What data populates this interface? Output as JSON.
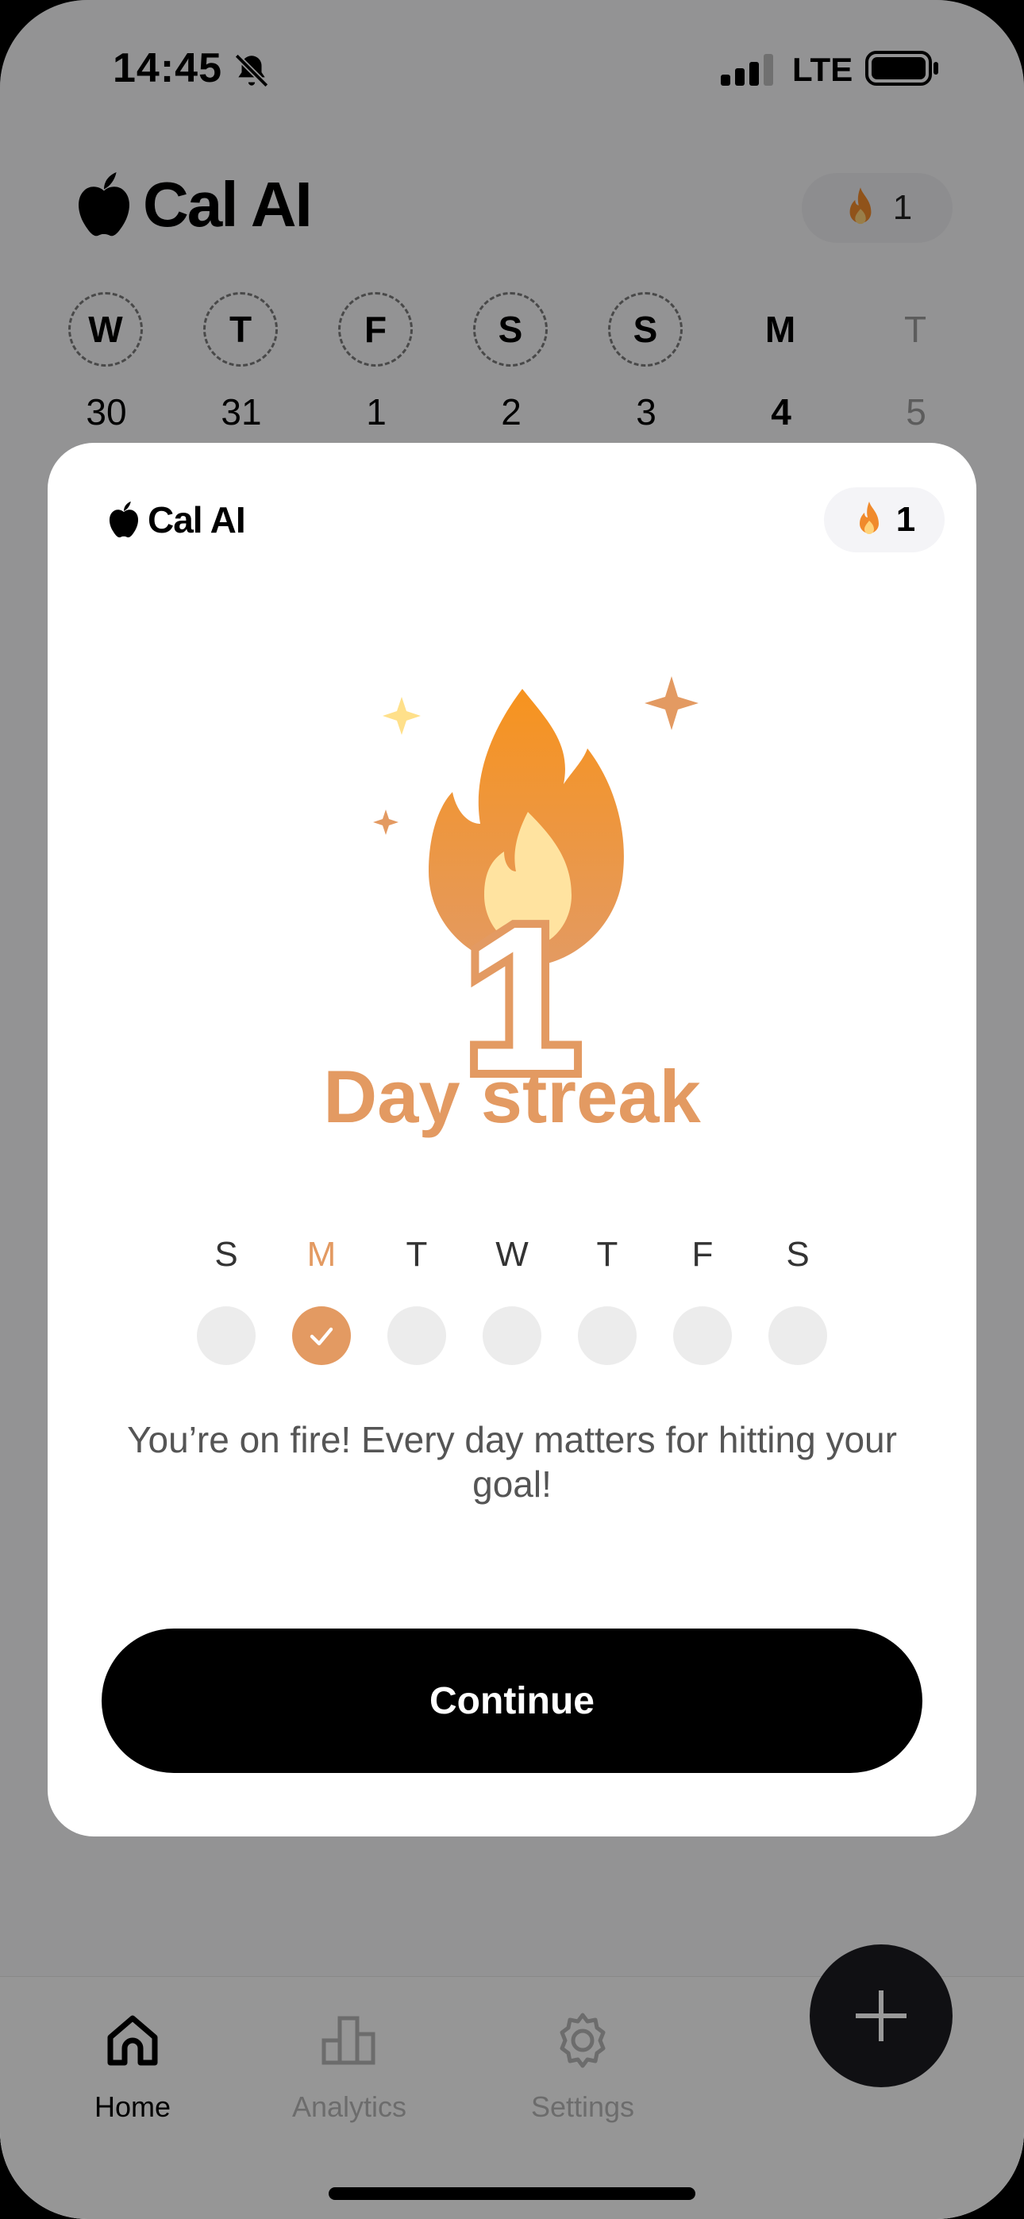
{
  "status_bar": {
    "time": "14:45",
    "network": "LTE",
    "icons": [
      "bell-slash-icon",
      "signal-icon",
      "battery-icon"
    ]
  },
  "app": {
    "name": "Cal AI",
    "streak_count": "1"
  },
  "week_strip": [
    {
      "letter": "W",
      "date": "30",
      "state": "past"
    },
    {
      "letter": "T",
      "date": "31",
      "state": "past"
    },
    {
      "letter": "F",
      "date": "1",
      "state": "past"
    },
    {
      "letter": "S",
      "date": "2",
      "state": "past"
    },
    {
      "letter": "S",
      "date": "3",
      "state": "past"
    },
    {
      "letter": "M",
      "date": "4",
      "state": "today"
    },
    {
      "letter": "T",
      "date": "5",
      "state": "future"
    }
  ],
  "modal": {
    "brand": "Cal AI",
    "streak_count": "1",
    "hero_number": "1",
    "title": "Day streak",
    "week": [
      {
        "label": "S",
        "done": false
      },
      {
        "label": "M",
        "done": true
      },
      {
        "label": "T",
        "done": false
      },
      {
        "label": "W",
        "done": false
      },
      {
        "label": "T",
        "done": false
      },
      {
        "label": "F",
        "done": false
      },
      {
        "label": "S",
        "done": false
      }
    ],
    "message": "You’re on fire! Every day matters for hitting your goal!",
    "continue_label": "Continue"
  },
  "tabbar": {
    "tabs": [
      {
        "label": "Home",
        "icon": "home-icon",
        "active": true
      },
      {
        "label": "Analytics",
        "icon": "bar-chart-icon",
        "active": false
      },
      {
        "label": "Settings",
        "icon": "gear-icon",
        "active": false
      }
    ],
    "fab_icon": "plus-icon"
  },
  "colors": {
    "accent": "#e39a62",
    "flame_top": "#f7931e",
    "flame_inner": "#ffe3a0",
    "dim_overlay": "rgba(0,0,0,0.40)"
  }
}
